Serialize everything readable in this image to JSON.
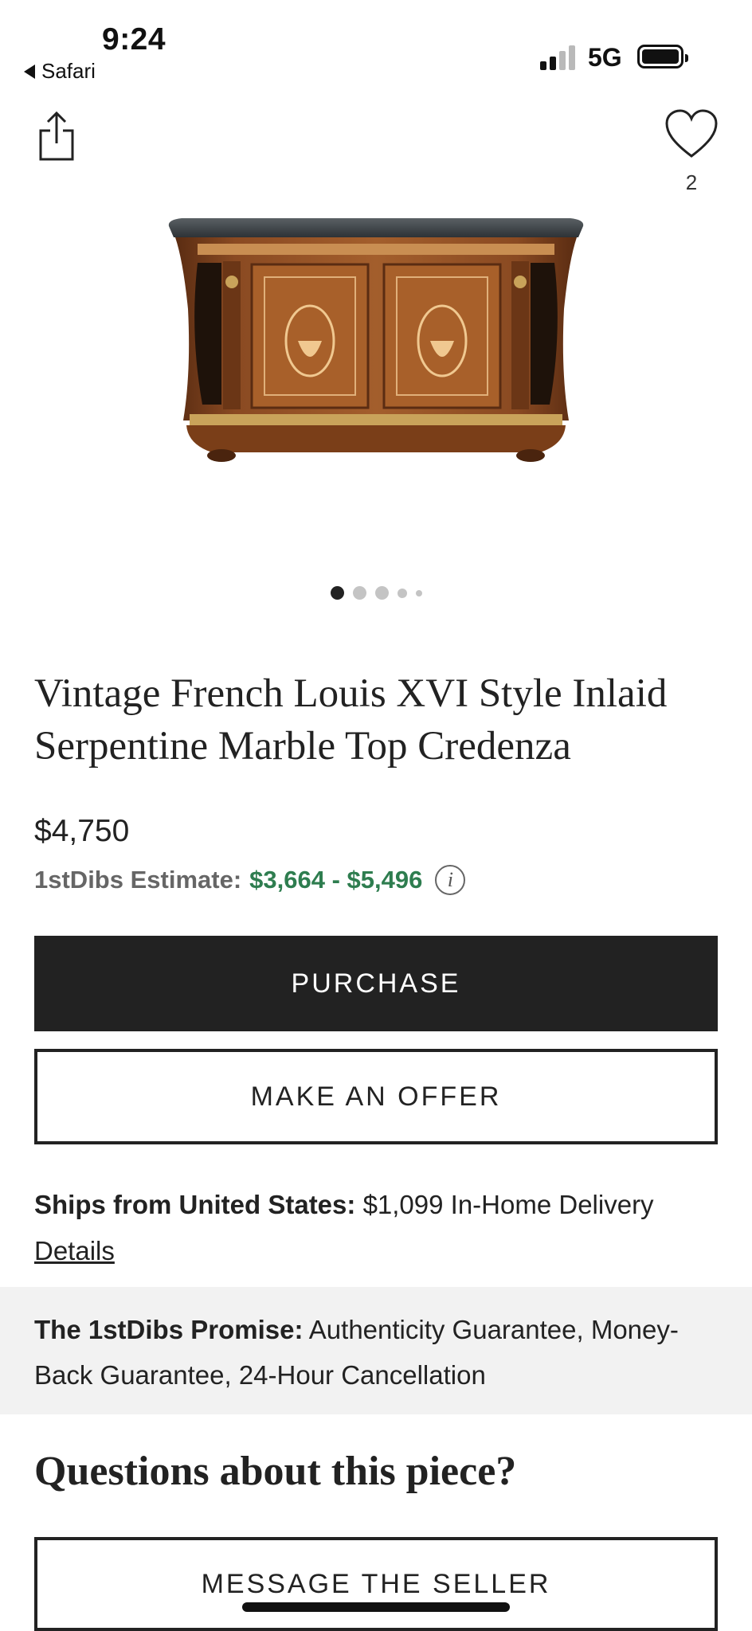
{
  "status_bar": {
    "time": "9:24",
    "back_app": "Safari",
    "network": "5G",
    "signal_icon": "cellular-signal-icon",
    "battery_icon": "battery-icon"
  },
  "header": {
    "share_icon": "share-icon",
    "favorite_icon": "heart-icon",
    "favorite_count": "2"
  },
  "carousel": {
    "total_dots": 5,
    "active_index": 0
  },
  "product": {
    "title": "Vintage French Louis XVI Style Inlaid Serpentine Marble Top Credenza",
    "price": "$4,750",
    "estimate_label": "1stDibs Estimate:",
    "estimate_range": "$3,664 - $5,496",
    "info_glyph": "i"
  },
  "actions": {
    "purchase_label": "PURCHASE",
    "offer_label": "MAKE AN OFFER",
    "message_label": "MESSAGE THE SELLER"
  },
  "shipping": {
    "label": "Ships from United States:",
    "value": "$1,099 In-Home Delivery",
    "details_link": "Details"
  },
  "promise": {
    "label": "The 1stDibs Promise:",
    "text": "Authenticity Guarantee, Money-Back Guarantee, 24-Hour Cancellation"
  },
  "questions_heading": "Questions about this piece?",
  "colors": {
    "primary_dark": "#222222",
    "estimate_green": "#2e7d4f",
    "promise_background": "#f2f2f2"
  }
}
